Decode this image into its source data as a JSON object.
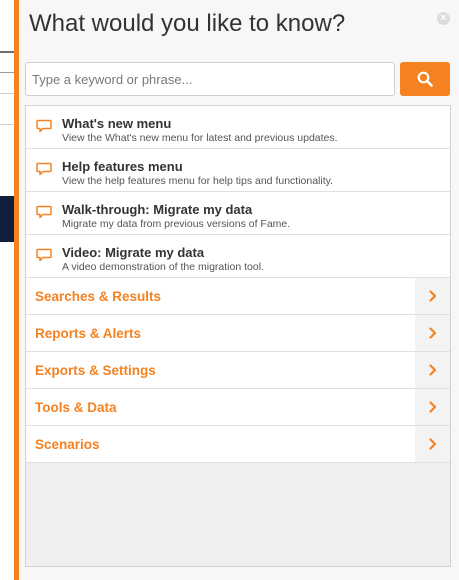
{
  "title": "What would you like to know?",
  "search": {
    "placeholder": "Type a keyword or phrase...",
    "value": ""
  },
  "help_items": [
    {
      "title": "What's new menu",
      "description": "View the What's new menu for latest and previous updates."
    },
    {
      "title": "Help features menu",
      "description": "View the help features menu for help tips and functionality."
    },
    {
      "title": "Walk-through: Migrate my data",
      "description": "Migrate my data from previous versions of Fame."
    },
    {
      "title": "Video: Migrate my data",
      "description": "A video demonstration of the migration tool."
    }
  ],
  "categories": [
    {
      "label": "Searches & Results"
    },
    {
      "label": "Reports & Alerts"
    },
    {
      "label": "Exports & Settings"
    },
    {
      "label": "Tools & Data"
    },
    {
      "label": "Scenarios"
    }
  ],
  "icons": {
    "close": "close-icon",
    "search": "magnifier-icon",
    "help_item": "speech-bubble-icon",
    "category": "chevron-right-icon"
  },
  "colors": {
    "accent": "#f58220",
    "text": "#333333",
    "panel_bg": "#f7f7f7"
  }
}
